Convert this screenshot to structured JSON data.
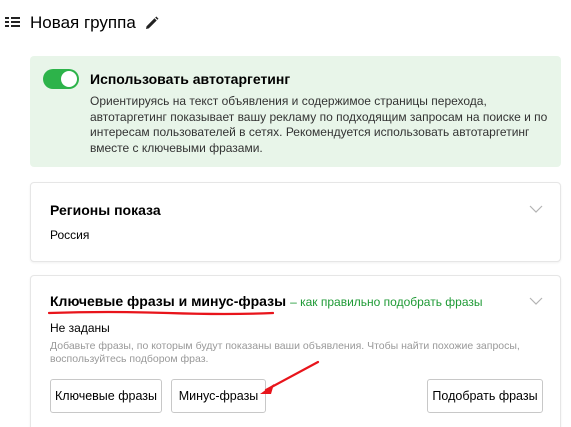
{
  "header": {
    "title": "Новая группа"
  },
  "autotargeting": {
    "enabled": true,
    "title": "Использовать автотаргетинг",
    "description": "Ориентируясь на текст объявления и содержимое страницы перехода, автотаргетинг показывает вашу рекламу по подходящим запросам на поиске и по интересам пользователей в сетях. Рекомендуется использовать автотаргетинг вместе с ключевыми фразами.",
    "accent_color": "#2db34a",
    "panel_color": "#e8f5e9"
  },
  "regions": {
    "title": "Регионы показа",
    "value": "Россия"
  },
  "keywords": {
    "title": "Ключевые фразы и минус-фразы",
    "help_link": "– как правильно подобрать фразы",
    "status": "Не заданы",
    "hint": "Добавьте фразы, по которым будут показаны ваши объявления. Чтобы найти похожие запросы, воспользуйтесь подбором фраз.",
    "buttons": {
      "keywords": "Ключевые фразы",
      "minus": "Минус-фразы",
      "pick": "Подобрать фразы"
    }
  },
  "annotations": {
    "color": "#e8141b"
  }
}
